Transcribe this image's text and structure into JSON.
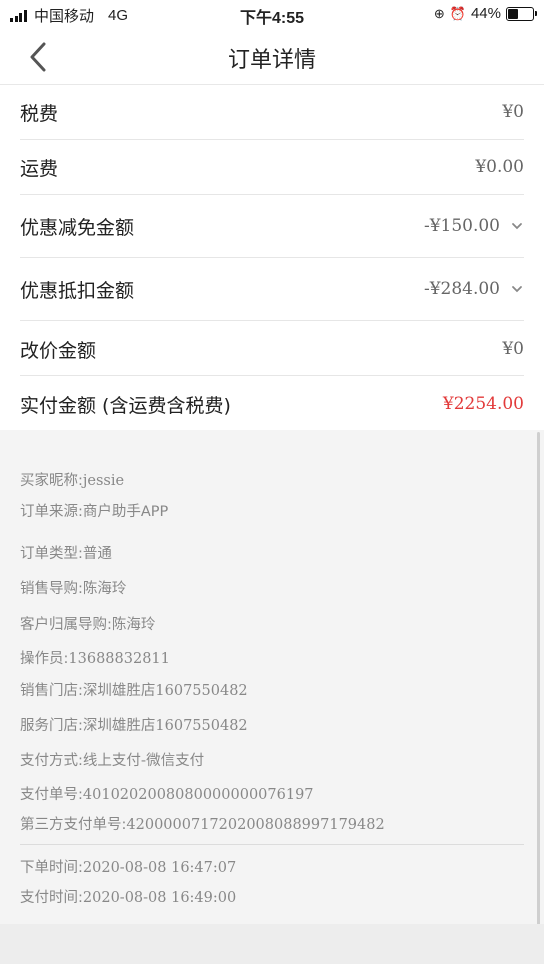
{
  "status_bar": {
    "carrier": "中国移动",
    "network": "4G",
    "time": "下午4:55",
    "battery": "44%",
    "battery_level": 0.44,
    "icons": [
      "orientation-lock-icon",
      "alarm-icon"
    ]
  },
  "nav": {
    "title": "订单详情",
    "back_icon": "chevron-left-icon"
  },
  "amounts": [
    {
      "label": "税费",
      "value": "¥0",
      "expandable": false
    },
    {
      "label": "运费",
      "value": "¥0.00",
      "expandable": false
    },
    {
      "label": "优惠减免金额",
      "value": "-¥150.00",
      "expandable": true
    },
    {
      "label": "优惠抵扣金额",
      "value": "-¥284.00",
      "expandable": true
    },
    {
      "label": "改价金额",
      "value": "¥0",
      "expandable": false
    },
    {
      "label": "实付金额 (含运费含税费)",
      "value": "¥2254.00",
      "expandable": false,
      "highlight": "#e23a3a"
    }
  ],
  "info": {
    "buyer_nickname": {
      "label": "买家昵称:",
      "value": "jessie"
    },
    "order_source": {
      "label": "订单来源:",
      "value": "商户助手APP"
    },
    "order_type": {
      "label": "订单类型:",
      "value": "普通"
    },
    "sales_guide": {
      "label": "销售导购:",
      "value": "陈海玲"
    },
    "customer_guide": {
      "label": "客户归属导购:",
      "value": "陈海玲"
    },
    "operator": {
      "label": "操作员:",
      "value": "13688832811"
    },
    "sales_store": {
      "label": "销售门店:",
      "value": "深圳雄胜店1607550482"
    },
    "service_store": {
      "label": "服务门店:",
      "value": "深圳雄胜店1607550482"
    },
    "payment_method": {
      "label": "支付方式:",
      "value": "线上支付-微信支付"
    },
    "payment_no": {
      "label": "支付单号:",
      "value": "4010202008080000000076197"
    },
    "third_party_no": {
      "label": "第三方支付单号:",
      "value": "4200000717202008088997179482"
    },
    "order_time": {
      "label": "下单时间:",
      "value": "2020-08-08 16:47:07"
    },
    "pay_time": {
      "label": "支付时间:",
      "value": "2020-08-08 16:49:00"
    }
  }
}
